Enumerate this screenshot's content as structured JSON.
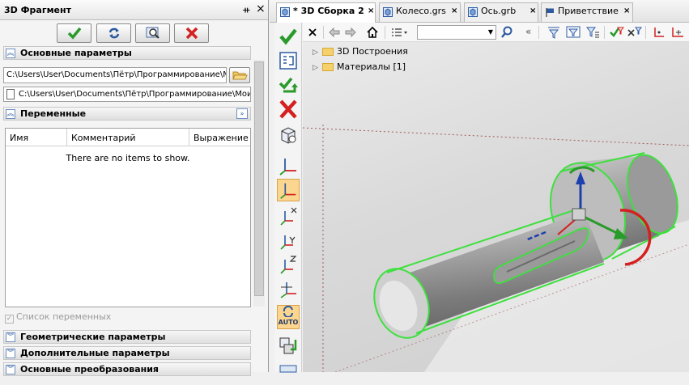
{
  "panel": {
    "title": "3D Фрагмент",
    "pin_glyph": "ᚑ",
    "close_glyph": "×"
  },
  "sections": {
    "basic_params": "Основные параметры",
    "variables": "Переменные",
    "geometric_params": "Геометрические параметры",
    "additional_params": "Дополнительные параметры",
    "basic_transforms": "Основные преобразования"
  },
  "fields": {
    "path_main": "C:\\Users\\User\\Documents\\Пётр\\Программирование\\М",
    "path_second": "C:\\Users\\User\\Documents\\Пётр\\Программирование\\Мои с"
  },
  "table": {
    "columns": [
      "Имя",
      "Комментарий",
      "Выражение"
    ],
    "empty_text": "There are no items to show."
  },
  "variables_list_checkbox": "Список переменных",
  "tabs": [
    {
      "label": "* 3D Сборка 2",
      "close": "×",
      "active": true
    },
    {
      "label": "Колесо.grs",
      "close": "×",
      "active": false
    },
    {
      "label": "Ось.grb",
      "close": "×",
      "active": false
    },
    {
      "label": "Приветствие",
      "close": "×",
      "active": false
    }
  ],
  "tree": [
    {
      "label": "3D Построения"
    },
    {
      "label": "Материалы [1]"
    }
  ],
  "toolbar": {
    "auto_label": "AUTO",
    "filter_value": ""
  },
  "colors": {
    "accent_blue": "#2c5aa0",
    "confirm_green": "#2a9a2a",
    "cancel_red": "#d42020",
    "selection_green": "#3ee03e",
    "highlight_orange": "#fcd58e"
  }
}
